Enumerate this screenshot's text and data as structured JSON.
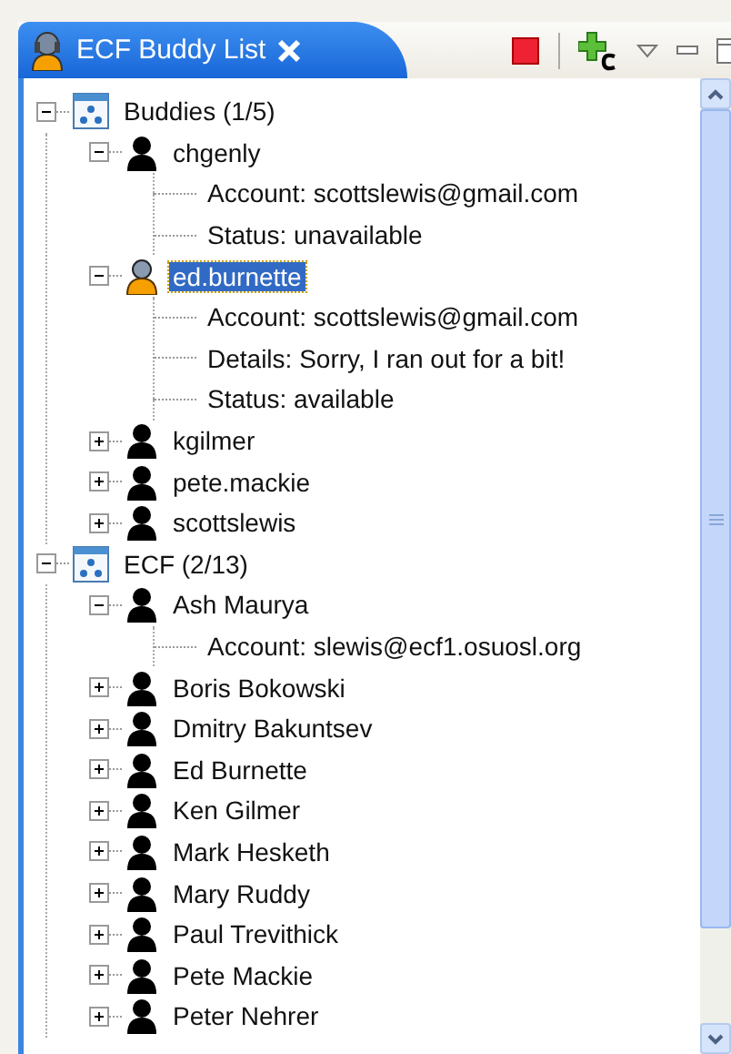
{
  "view": {
    "title": "ECF Buddy List"
  },
  "groups": [
    {
      "name": "Buddies (1/5)",
      "expanded": true,
      "buddies": [
        {
          "name": "chgenly",
          "online": false,
          "selected": false,
          "expanded": true,
          "details": [
            "Account: scottslewis@gmail.com",
            "Status: unavailable"
          ]
        },
        {
          "name": "ed.burnette",
          "online": true,
          "selected": true,
          "expanded": true,
          "details": [
            "Account: scottslewis@gmail.com",
            "Details: Sorry, I ran out for a bit!",
            "Status: available"
          ]
        },
        {
          "name": "kgilmer",
          "online": false,
          "selected": false,
          "expanded": false
        },
        {
          "name": "pete.mackie",
          "online": false,
          "selected": false,
          "expanded": false
        },
        {
          "name": "scottslewis",
          "online": false,
          "selected": false,
          "expanded": false
        }
      ]
    },
    {
      "name": "ECF (2/13)",
      "expanded": true,
      "buddies": [
        {
          "name": "Ash Maurya",
          "online": false,
          "selected": false,
          "expanded": true,
          "details": [
            "Account: slewis@ecf1.osuosl.org"
          ]
        },
        {
          "name": "Boris Bokowski",
          "online": false,
          "selected": false,
          "expanded": false
        },
        {
          "name": "Dmitry Bakuntsev",
          "online": false,
          "selected": false,
          "expanded": false
        },
        {
          "name": "Ed Burnette",
          "online": false,
          "selected": false,
          "expanded": false
        },
        {
          "name": "Ken Gilmer",
          "online": false,
          "selected": false,
          "expanded": false
        },
        {
          "name": "Mark Hesketh",
          "online": false,
          "selected": false,
          "expanded": false
        },
        {
          "name": "Mary Ruddy",
          "online": false,
          "selected": false,
          "expanded": false
        },
        {
          "name": "Paul Trevithick",
          "online": false,
          "selected": false,
          "expanded": false
        },
        {
          "name": "Pete Mackie",
          "online": false,
          "selected": false,
          "expanded": false
        },
        {
          "name": "Peter Nehrer",
          "online": false,
          "selected": false,
          "expanded": false
        }
      ]
    }
  ]
}
